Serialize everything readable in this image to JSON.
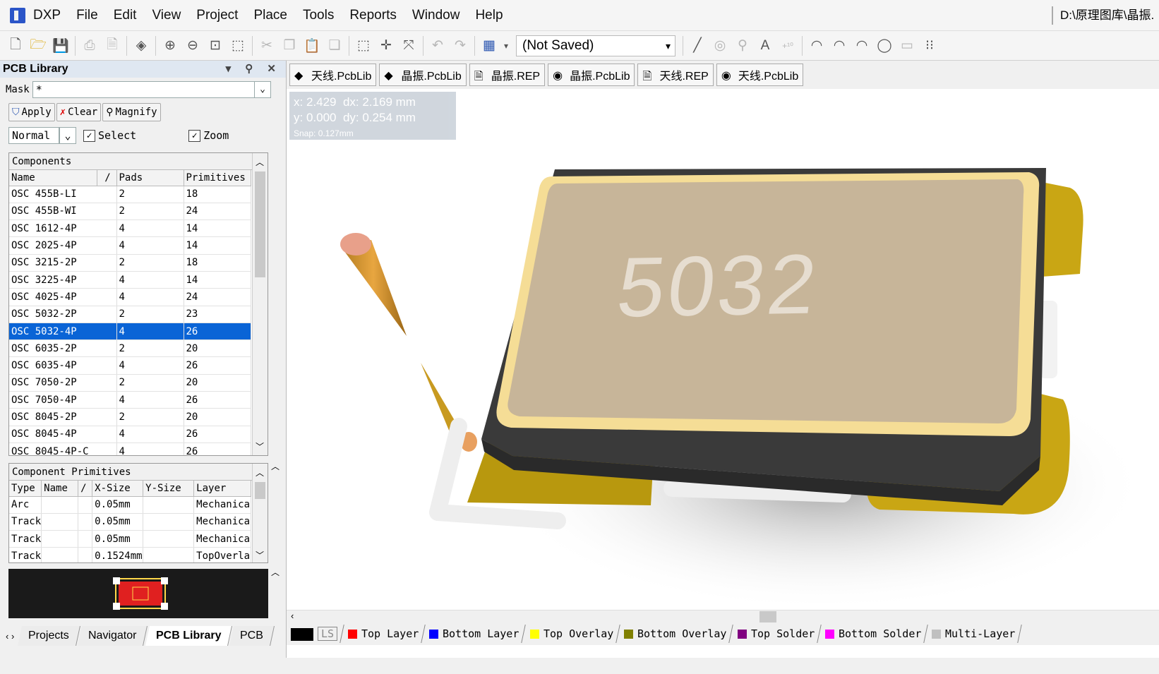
{
  "menubar": {
    "items": [
      "DXP",
      "File",
      "Edit",
      "View",
      "Project",
      "Place",
      "Tools",
      "Reports",
      "Window",
      "Help"
    ],
    "path": "D:\\原理图库\\晶振."
  },
  "toolbar": {
    "document_select": "(Not Saved)"
  },
  "panel": {
    "title": "PCB Library",
    "mask_label": "Mask",
    "mask_value": "*",
    "apply_label": "Apply",
    "clear_label": "Clear",
    "magnify_label": "Magnify",
    "mode_value": "Normal",
    "select_label": "Select",
    "zoom_label": "Zoom",
    "select_checked": true,
    "zoom_checked": true,
    "components": {
      "header": "Components",
      "columns": [
        "Name",
        "/",
        "Pads",
        "Primitives"
      ],
      "rows": [
        {
          "name": "OSC 455B-LI",
          "pads": "2",
          "prims": "18"
        },
        {
          "name": "OSC 455B-WI",
          "pads": "2",
          "prims": "24"
        },
        {
          "name": "OSC 1612-4P",
          "pads": "4",
          "prims": "14"
        },
        {
          "name": "OSC 2025-4P",
          "pads": "4",
          "prims": "14"
        },
        {
          "name": "OSC 3215-2P",
          "pads": "2",
          "prims": "18"
        },
        {
          "name": "OSC 3225-4P",
          "pads": "4",
          "prims": "14"
        },
        {
          "name": "OSC 4025-4P",
          "pads": "4",
          "prims": "24"
        },
        {
          "name": "OSC 5032-2P",
          "pads": "2",
          "prims": "23"
        },
        {
          "name": "OSC 5032-4P",
          "pads": "4",
          "prims": "26",
          "selected": true
        },
        {
          "name": "OSC 6035-2P",
          "pads": "2",
          "prims": "20"
        },
        {
          "name": "OSC 6035-4P",
          "pads": "4",
          "prims": "26"
        },
        {
          "name": "OSC 7050-2P",
          "pads": "2",
          "prims": "20"
        },
        {
          "name": "OSC 7050-4P",
          "pads": "4",
          "prims": "26"
        },
        {
          "name": "OSC 8045-2P",
          "pads": "2",
          "prims": "20"
        },
        {
          "name": "OSC 8045-4P",
          "pads": "4",
          "prims": "26"
        },
        {
          "name": "OSC 8045-4P-C",
          "pads": "4",
          "prims": "26"
        }
      ]
    },
    "primitives": {
      "header": "Component Primitives",
      "columns": [
        "Type",
        "Name",
        "/",
        "X-Size",
        "Y-Size",
        "Layer"
      ],
      "rows": [
        {
          "type": "Arc",
          "xsize": "0.05mm",
          "layer": "Mechanica"
        },
        {
          "type": "Track",
          "xsize": "0.05mm",
          "layer": "Mechanica"
        },
        {
          "type": "Track",
          "xsize": "0.05mm",
          "layer": "Mechanica"
        },
        {
          "type": "Track",
          "xsize": "0.1524mm",
          "layer": "TopOverla"
        }
      ]
    },
    "tabs": [
      "Projects",
      "Navigator",
      "PCB Library",
      "PCB"
    ]
  },
  "doctabs": [
    {
      "label": "天线.PcbLib",
      "icon": "pcblib-icon"
    },
    {
      "label": "晶振.PcbLib",
      "icon": "pcblib-icon"
    },
    {
      "label": "晶振.REP",
      "icon": "report-icon"
    },
    {
      "label": "晶振.PcbLib",
      "icon": "web-icon"
    },
    {
      "label": "天线.REP",
      "icon": "report-icon"
    },
    {
      "label": "天线.PcbLib",
      "icon": "web-icon"
    }
  ],
  "canvas": {
    "coord_x": "x: 2.429",
    "coord_dx": "dx: 2.169 mm",
    "coord_y": "y: 0.000",
    "coord_dy": "dy: 0.254 mm",
    "snap": "Snap: 0.127mm",
    "component_marking": "5032"
  },
  "layers": [
    {
      "label": "LS",
      "color": "#000000"
    },
    {
      "label": "Top Layer",
      "color": "#ff0000"
    },
    {
      "label": "Bottom Layer",
      "color": "#0000ff"
    },
    {
      "label": "Top Overlay",
      "color": "#ffff00"
    },
    {
      "label": "Bottom Overlay",
      "color": "#808000"
    },
    {
      "label": "Top Solder",
      "color": "#800080"
    },
    {
      "label": "Bottom Solder",
      "color": "#ff00ff"
    },
    {
      "label": "Multi-Layer",
      "color": "#c0c0c0"
    }
  ]
}
